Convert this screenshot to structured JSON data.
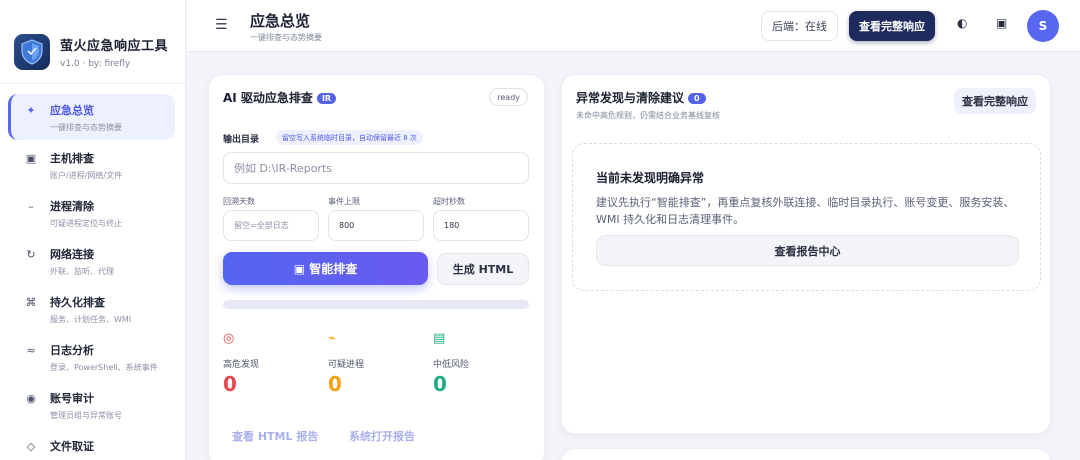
{
  "app": {
    "title": "萤火应急响应工具",
    "version": "v1.0 · by: firefly"
  },
  "nav": [
    {
      "label": "应急总览",
      "desc": "一键排查与态势摘要",
      "icon": "✦"
    },
    {
      "label": "主机排查",
      "desc": "账户/进程/网络/文件",
      "icon": "▣"
    },
    {
      "label": "进程清除",
      "desc": "可疑进程定位与终止",
      "icon": "–"
    },
    {
      "label": "网络连接",
      "desc": "外联、监听、代理",
      "icon": "↻"
    },
    {
      "label": "持久化排查",
      "desc": "服务、计划任务、WMI",
      "icon": "⌘"
    },
    {
      "label": "日志分析",
      "desc": "登录、PowerShell、系统事件",
      "icon": "≈"
    },
    {
      "label": "账号审计",
      "desc": "管理员组与异常账号",
      "icon": "◉"
    },
    {
      "label": "文件取证",
      "desc": "",
      "icon": "◇"
    }
  ],
  "header": {
    "title": "应急总览",
    "subtitle": "一键排查与态势摘要",
    "backend_status": "后端：在线",
    "view_full_btn": "查看完整响应",
    "theme_icon": "◐",
    "layout_icon": "▣",
    "avatar": "S"
  },
  "ai_card": {
    "title": "AI 驱动应急排查",
    "badge": "IR",
    "status": "ready",
    "output_label": "输出目录",
    "output_hint": "留空写入系统临时目录，自动保留最近 8 次",
    "dir_placeholder": "例如 D:\\IR-Reports",
    "fields": [
      {
        "label": "回溯天数",
        "placeholder": "留空=全部日志",
        "value": ""
      },
      {
        "label": "事件上限",
        "placeholder": "",
        "value": "800"
      },
      {
        "label": "超时秒数",
        "placeholder": "",
        "value": "180"
      }
    ],
    "scan_btn": "▣ 智能排查",
    "gen_html_btn": "生成 HTML",
    "progress": 0,
    "stats": [
      {
        "icon": "◎",
        "label": "高危发现",
        "value": "0",
        "color": "#e5484d"
      },
      {
        "icon": "⌁",
        "label": "可疑进程",
        "value": "0",
        "color": "#f2a30f"
      },
      {
        "icon": "▤",
        "label": "中低风险",
        "value": "0",
        "color": "#1fae7a"
      }
    ],
    "view_html_link": "查看 HTML 报告",
    "open_report_link": "系统打开报告"
  },
  "anomaly_card": {
    "title": "异常发现与清除建议",
    "count": "0",
    "subtitle": "未命中高危规则，仍需结合业务基线复核",
    "view_full_btn": "查看完整响应",
    "empty_title": "当前未发现明确异常",
    "empty_text": "建议先执行“智能排查”，再重点复核外联连接、临时目录执行、账号变更、服务安装、WMI 持久化和日志清理事件。",
    "report_center_btn": "查看报告中心"
  },
  "colors": {
    "accent": "#5867f0",
    "dark_button": "#1f2a5e",
    "danger": "#e5484d",
    "warning": "#f2a30f",
    "success": "#1fae7a"
  }
}
